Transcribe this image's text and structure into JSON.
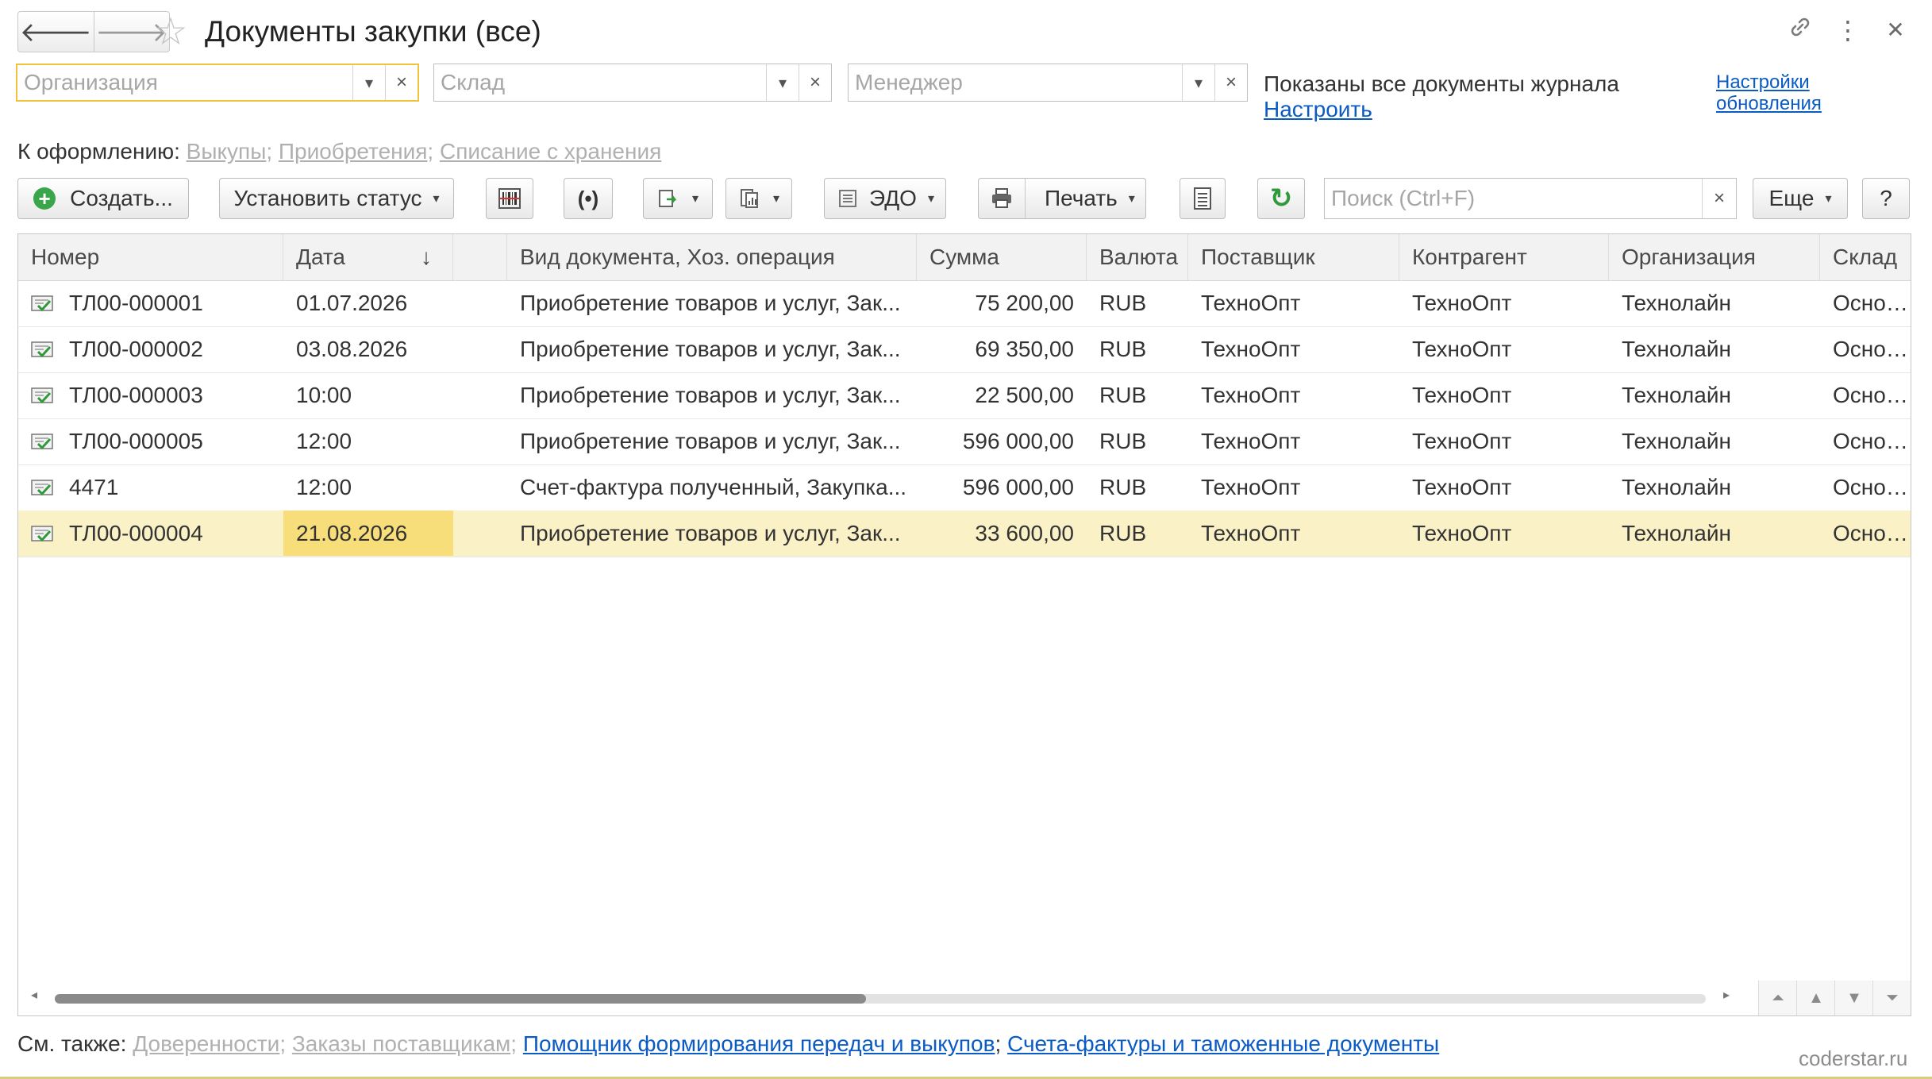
{
  "window": {
    "title": "Документы закупки (все)"
  },
  "filters": {
    "organization_placeholder": "Организация",
    "warehouse_placeholder": "Склад",
    "manager_placeholder": "Менеджер",
    "info_text": "Показаны все документы журнала",
    "configure_link": "Настроить",
    "update_settings_line1": "Настройки",
    "update_settings_line2": "обновления"
  },
  "to_process": {
    "label": "К оформлению:",
    "links": [
      "Выкупы",
      "Приобретения",
      "Списание с хранения"
    ]
  },
  "toolbar": {
    "create_label": "Создать...",
    "set_status_label": "Установить статус",
    "edo_label": "ЭДО",
    "print_label": "Печать",
    "search_placeholder": "Поиск (Ctrl+F)",
    "more_label": "Еще",
    "help_label": "?"
  },
  "table": {
    "columns": {
      "number": "Номер",
      "date": "Дата",
      "doc_type": "Вид документа, Хоз. операция",
      "sum": "Сумма",
      "currency": "Валюта",
      "supplier": "Поставщик",
      "counterparty": "Контрагент",
      "organization": "Организация",
      "warehouse": "Склад"
    },
    "rows": [
      {
        "number": "ТЛ00-000001",
        "date": "01.07.2026",
        "doc_type": "Приобретение товаров и услуг, Зак...",
        "sum": "75 200,00",
        "currency": "RUB",
        "supplier": "ТехноОпт",
        "counterparty": "ТехноОпт",
        "organization": "Технолайн",
        "warehouse": "Основно"
      },
      {
        "number": "ТЛ00-000002",
        "date": "03.08.2026",
        "doc_type": "Приобретение товаров и услуг, Зак...",
        "sum": "69 350,00",
        "currency": "RUB",
        "supplier": "ТехноОпт",
        "counterparty": "ТехноОпт",
        "organization": "Технолайн",
        "warehouse": "Основно"
      },
      {
        "number": "ТЛ00-000003",
        "date": "10:00",
        "doc_type": "Приобретение товаров и услуг, Зак...",
        "sum": "22 500,00",
        "currency": "RUB",
        "supplier": "ТехноОпт",
        "counterparty": "ТехноОпт",
        "organization": "Технолайн",
        "warehouse": "Основно"
      },
      {
        "number": "ТЛ00-000005",
        "date": "12:00",
        "doc_type": "Приобретение товаров и услуг, Зак...",
        "sum": "596 000,00",
        "currency": "RUB",
        "supplier": "ТехноОпт",
        "counterparty": "ТехноОпт",
        "organization": "Технолайн",
        "warehouse": "Основно"
      },
      {
        "number": "4471",
        "date": "12:00",
        "doc_type": "Счет-фактура полученный, Закупка...",
        "sum": "596 000,00",
        "currency": "RUB",
        "supplier": "ТехноОпт",
        "counterparty": "ТехноОпт",
        "organization": "Технолайн",
        "warehouse": "Основно"
      },
      {
        "number": "ТЛ00-000004",
        "date": "21.08.2026",
        "doc_type": "Приобретение товаров и услуг, Зак...",
        "sum": "33 600,00",
        "currency": "RUB",
        "supplier": "ТехноОпт",
        "counterparty": "ТехноОпт",
        "organization": "Технолайн",
        "warehouse": "Основно"
      }
    ],
    "selected_row": 5
  },
  "see_also": {
    "label": "См. также:",
    "links_inactive": [
      "Доверенности",
      "Заказы поставщикам"
    ],
    "links_active": [
      "Помощник формирования передач и выкупов",
      "Счета-фактуры и таможенные документы"
    ]
  },
  "watermark": "coderstar.ru",
  "icons": {
    "back": "arrow-left-icon",
    "forward": "arrow-right-icon",
    "favorite": "star-icon",
    "link": "link-icon",
    "menu": "more-vertical-icon",
    "close": "close-icon"
  },
  "colors": {
    "accent_yellow": "#f1c33d",
    "selected_row": "#fbf1c6",
    "selected_cell": "#f7de7a",
    "link_blue": "#0a5bc4",
    "inactive_link": "#b0b0b0",
    "create_green": "#3aa64a"
  }
}
